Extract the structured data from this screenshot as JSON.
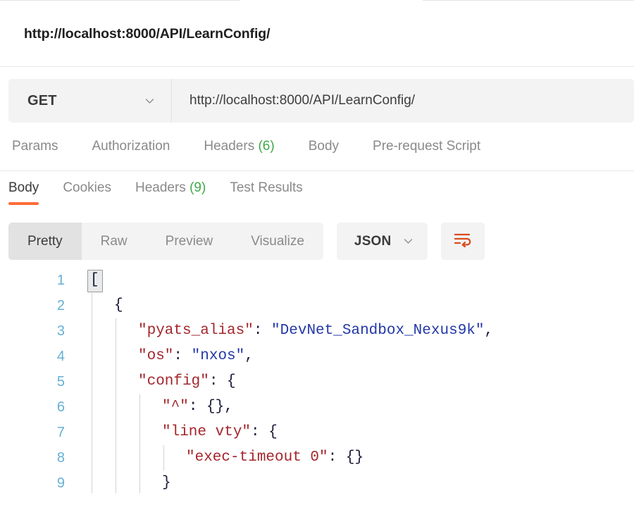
{
  "window": {
    "tab_strip_visible": true
  },
  "request": {
    "title": "http://localhost:8000/API/LearnConfig/",
    "method": "GET",
    "method_caret_icon": "chevron-down-icon",
    "url": "http://localhost:8000/API/LearnConfig/",
    "url_placeholder": "Enter request URL",
    "tabs": [
      {
        "label": "Params",
        "count": "",
        "active": false
      },
      {
        "label": "Authorization",
        "count": "",
        "active": false
      },
      {
        "label": "Headers",
        "count": "(6)",
        "active": false
      },
      {
        "label": "Body",
        "count": "",
        "active": false
      },
      {
        "label": "Pre-request Script",
        "count": "",
        "active": false
      }
    ]
  },
  "response": {
    "tabs": [
      {
        "label": "Body",
        "count": "",
        "active": true
      },
      {
        "label": "Cookies",
        "count": "",
        "active": false
      },
      {
        "label": "Headers",
        "count": "(9)",
        "active": false
      },
      {
        "label": "Test Results",
        "count": "",
        "active": false
      }
    ],
    "view_modes": [
      {
        "label": "Pretty",
        "active": true
      },
      {
        "label": "Raw",
        "active": false
      },
      {
        "label": "Preview",
        "active": false
      },
      {
        "label": "Visualize",
        "active": false
      }
    ],
    "format": {
      "label": "JSON",
      "caret_icon": "chevron-down-icon"
    },
    "wrap_button": {
      "icon": "word-wrap-icon"
    }
  },
  "colors": {
    "accent_orange": "#ff6c37",
    "count_green": "#41a849",
    "json_key": "#a3262c",
    "json_string": "#2337a8",
    "json_punct": "#1a1a3a",
    "line_number": "#66b0d6",
    "toolbar_bg": "#f3f3f3",
    "segment_active_bg": "#e2e2e2",
    "divider": "#e8e8e8"
  },
  "code": {
    "language": "json",
    "lines": [
      {
        "no": "1",
        "indent": 0,
        "tokens": [
          {
            "t": "pun",
            "v": "["
          }
        ]
      },
      {
        "no": "2",
        "indent": 1,
        "tokens": [
          {
            "t": "pun",
            "v": "{"
          }
        ]
      },
      {
        "no": "3",
        "indent": 2,
        "tokens": [
          {
            "t": "key",
            "v": "\"pyats_alias\""
          },
          {
            "t": "pun",
            "v": ": "
          },
          {
            "t": "str",
            "v": "\"DevNet_Sandbox_Nexus9k\""
          },
          {
            "t": "pun",
            "v": ","
          }
        ]
      },
      {
        "no": "4",
        "indent": 2,
        "tokens": [
          {
            "t": "key",
            "v": "\"os\""
          },
          {
            "t": "pun",
            "v": ": "
          },
          {
            "t": "str",
            "v": "\"nxos\""
          },
          {
            "t": "pun",
            "v": ","
          }
        ]
      },
      {
        "no": "5",
        "indent": 2,
        "tokens": [
          {
            "t": "key",
            "v": "\"config\""
          },
          {
            "t": "pun",
            "v": ": {"
          }
        ]
      },
      {
        "no": "6",
        "indent": 3,
        "tokens": [
          {
            "t": "key",
            "v": "\"^\""
          },
          {
            "t": "pun",
            "v": ": {},"
          }
        ]
      },
      {
        "no": "7",
        "indent": 3,
        "tokens": [
          {
            "t": "key",
            "v": "\"line vty\""
          },
          {
            "t": "pun",
            "v": ": {"
          }
        ]
      },
      {
        "no": "8",
        "indent": 4,
        "tokens": [
          {
            "t": "key",
            "v": "\"exec-timeout 0\""
          },
          {
            "t": "pun",
            "v": ": {}"
          }
        ]
      },
      {
        "no": "9",
        "indent": 3,
        "tokens": [
          {
            "t": "pun",
            "v": "}"
          }
        ]
      }
    ],
    "raw_text": "[\n    {\n        \"pyats_alias\": \"DevNet_Sandbox_Nexus9k\",\n        \"os\": \"nxos\",\n        \"config\": {\n            \"^\": {},\n            \"line vty\": {\n                \"exec-timeout 0\": {}\n            }"
  }
}
